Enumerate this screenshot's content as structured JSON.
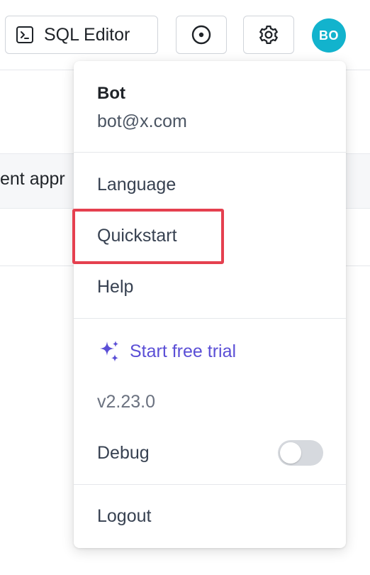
{
  "header": {
    "sql_editor_label": "SQL Editor",
    "avatar_initials": "BO",
    "avatar_color": "#12b3cd"
  },
  "background": {
    "row_text": "ent appr"
  },
  "menu": {
    "user_name": "Bot",
    "user_email": "bot@x.com",
    "items": {
      "language": "Language",
      "quickstart": "Quickstart",
      "help": "Help"
    },
    "trial_label": "Start free trial",
    "trial_color": "#5b4fd6",
    "version": "v2.23.0",
    "debug_label": "Debug",
    "debug_enabled": false,
    "logout_label": "Logout"
  },
  "highlight_color": "#e5404f",
  "icons": {
    "sql_editor": "terminal-icon",
    "radio": "radio-circle-icon",
    "settings": "gear-icon",
    "trial": "sparkle-icon"
  }
}
